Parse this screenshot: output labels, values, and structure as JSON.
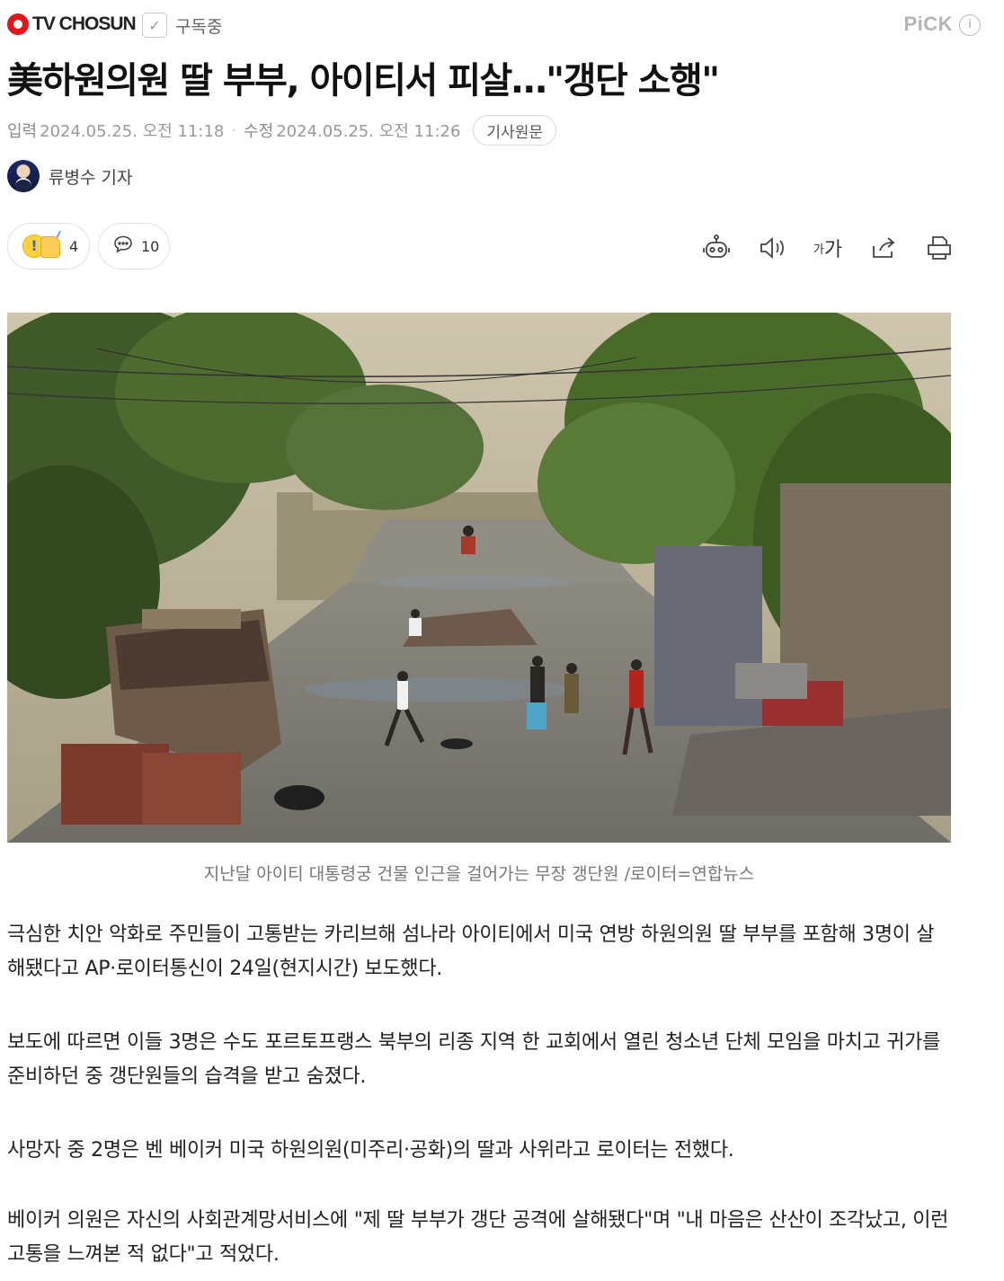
{
  "header": {
    "brand": "TV CHOSUN",
    "subscribe_label": "구독중",
    "pick_label": "PiCK",
    "pick_info": "i"
  },
  "article": {
    "headline": "美하원의원 딸 부부, 아이티서 피살…\"갱단 소행\"",
    "meta": {
      "input_label": "입력",
      "input_time": "2024.05.25. 오전 11:18",
      "edit_label": "수정",
      "edit_time": "2024.05.25. 오전 11:26",
      "origin_button": "기사원문"
    },
    "author": "류병수 기자",
    "reactions": {
      "count": "4"
    },
    "comments": {
      "count": "10"
    },
    "toolbar": {
      "font_size_small": "가",
      "font_size_large": "가",
      "icons": [
        "robot-summary-icon",
        "speaker-icon",
        "font-size-icon",
        "share-icon",
        "print-icon"
      ]
    },
    "photo_caption": "지난달 아이티 대통령궁 건물 인근을 걸어가는 무장 갱단원 /로이터=연합뉴스",
    "paragraphs": [
      "극심한 치안 악화로 주민들이 고통받는 카리브해 섬나라 아이티에서 미국 연방 하원의원 딸 부부를 포함해  3명이 살해됐다고 AP·로이터통신이 24일(현지시간) 보도했다.",
      "보도에 따르면 이들 3명은 수도 포르토프랭스 북부의 리종 지역 한 교회에서 열린 청소년 단체 모임을 마치고 귀가를 준비하던 중 갱단원들의 습격을 받고 숨졌다.",
      "사망자 중 2명은 벤 베이커 미국 하원의원(미주리·공화)의 딸과 사위라고 로이터는 전했다.",
      "베이커 의원은 자신의 사회관계망서비스에 \"제 딸 부부가 갱단 공격에 살해됐다\"며 \"내 마음은 산산이 조각났고, 이런 고통을 느껴본 적 없다\"고 적었다."
    ]
  },
  "colors": {
    "brand_red": "#e2151b",
    "text": "#222222",
    "muted": "#8b8b8b"
  }
}
